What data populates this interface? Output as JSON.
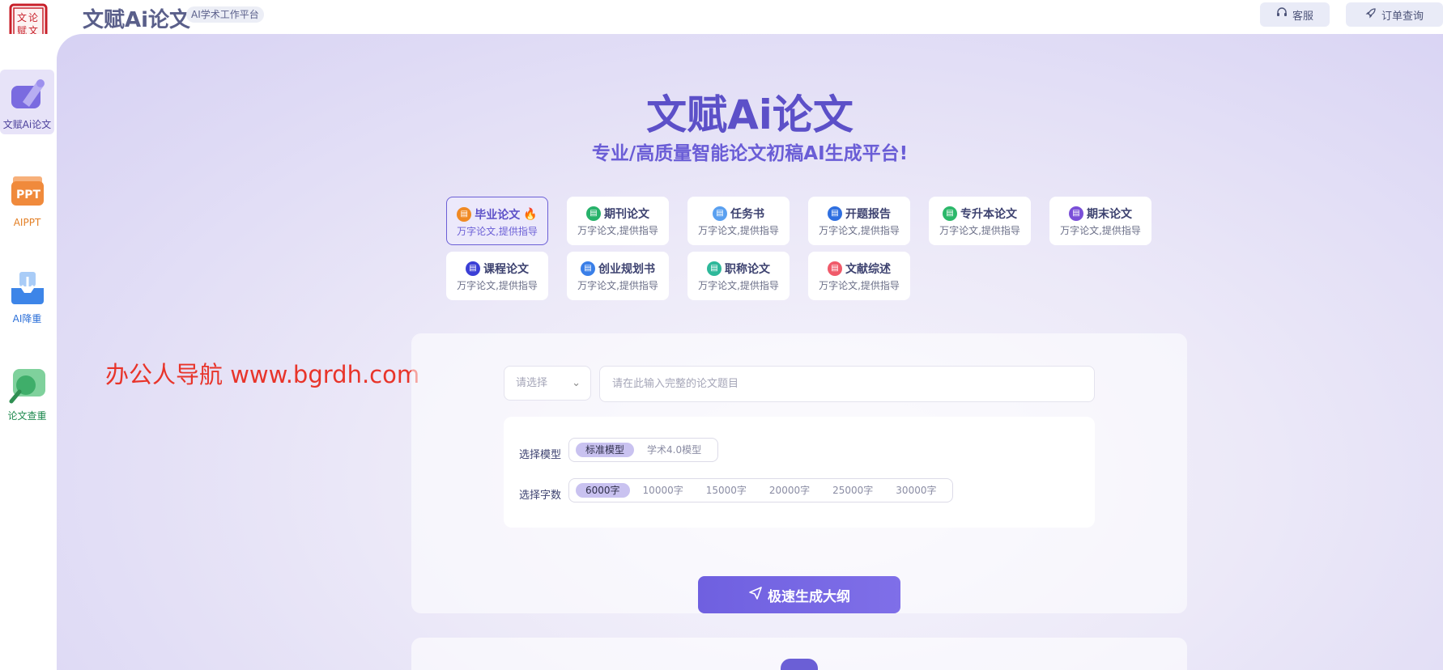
{
  "header": {
    "app_title": "文赋Ai论文",
    "tag": "AI学术工作平台",
    "service_label": "客服",
    "orders_label": "订单查询",
    "logo_text": "文论赋文"
  },
  "sidebar": {
    "items": [
      {
        "label": "文赋Ai论文",
        "color": "#4a3f9a",
        "icon": "pen-icon"
      },
      {
        "label": "AIPPT",
        "color": "#e37f24",
        "icon": "ppt-icon"
      },
      {
        "label": "AI降重",
        "color": "#2b6fd8",
        "icon": "download-tray-icon"
      },
      {
        "label": "论文查重",
        "color": "#1f8a4f",
        "icon": "magnifier-icon"
      }
    ]
  },
  "hero": {
    "title": "文赋Ai论文",
    "subtitle": "专业/高质量智能论文初稿AI生成平台!"
  },
  "paper_types": [
    {
      "name": "毕业论文",
      "desc": "万字论文,提供指导",
      "icon_color": "#f08a24",
      "hot": true
    },
    {
      "name": "期刊论文",
      "desc": "万字论文,提供指导",
      "icon_color": "#27b26a"
    },
    {
      "name": "任务书",
      "desc": "万字论文,提供指导",
      "icon_color": "#5aa0f0"
    },
    {
      "name": "开题报告",
      "desc": "万字论文,提供指导",
      "icon_color": "#2f6fe0"
    },
    {
      "name": "专升本论文",
      "desc": "万字论文,提供指导",
      "icon_color": "#2cb86a"
    },
    {
      "name": "期末论文",
      "desc": "万字论文,提供指导",
      "icon_color": "#7a4fd8"
    },
    {
      "name": "课程论文",
      "desc": "万字论文,提供指导",
      "icon_color": "#3b3fd6"
    },
    {
      "name": "创业规划书",
      "desc": "万字论文,提供指导",
      "icon_color": "#3a7fe8"
    },
    {
      "name": "职称论文",
      "desc": "万字论文,提供指导",
      "icon_color": "#2eb89a"
    },
    {
      "name": "文献综述",
      "desc": "万字论文,提供指导",
      "icon_color": "#f05a6a"
    }
  ],
  "watermark": "办公人导航  www.bgrdh.com",
  "form": {
    "select_placeholder": "请选择",
    "title_placeholder": "请在此输入完整的论文题目",
    "model_label": "选择模型",
    "models": [
      "标准模型",
      "学术4.0模型"
    ],
    "selected_model": "标准模型",
    "words_label": "选择字数",
    "word_options": [
      "6000字",
      "10000字",
      "15000字",
      "20000字",
      "25000字",
      "30000字"
    ],
    "selected_words": "6000字",
    "generate_label": "极速生成大纲"
  }
}
